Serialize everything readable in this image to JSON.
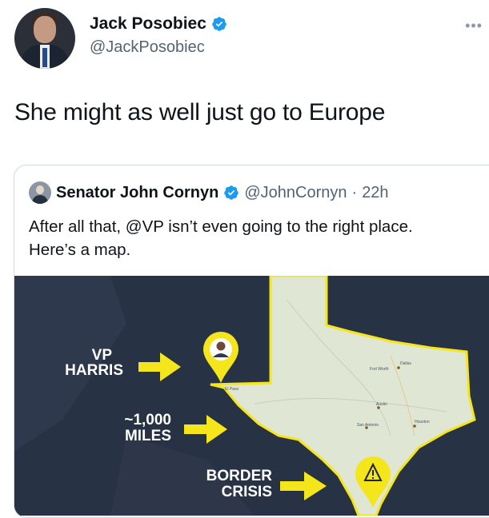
{
  "tweet": {
    "author_name": "Jack Posobiec",
    "author_handle": "@JackPosobiec",
    "more_icon": "more-icon",
    "text": "She might as well just go to Europe"
  },
  "quoted": {
    "author_name": "Senator John Cornyn",
    "author_handle": "@JohnCornyn",
    "separator": "·",
    "time": "22h",
    "text": "After all that, @VP isn’t even going to the right place. Here’s a map.",
    "map": {
      "labels": {
        "vp_line1": "VP",
        "vp_line2": "HARRIS",
        "miles_line1": "~1,000",
        "miles_line2": "MILES",
        "border_line1": "BORDER",
        "border_line2": "CRISIS"
      },
      "cities": {
        "el_paso": "El Paso",
        "fort_worth": "Fort Worth",
        "dallas": "Dallas",
        "austin": "Austin",
        "san_antonio": "San Antonio",
        "houston": "Houston"
      },
      "colors": {
        "accent": "#f5e51b",
        "texas_fill": "#dfe6d3",
        "background": "#283245"
      }
    }
  },
  "colors": {
    "verified": "#1d9bf0",
    "text": "#0f1419",
    "muted": "#536471"
  }
}
